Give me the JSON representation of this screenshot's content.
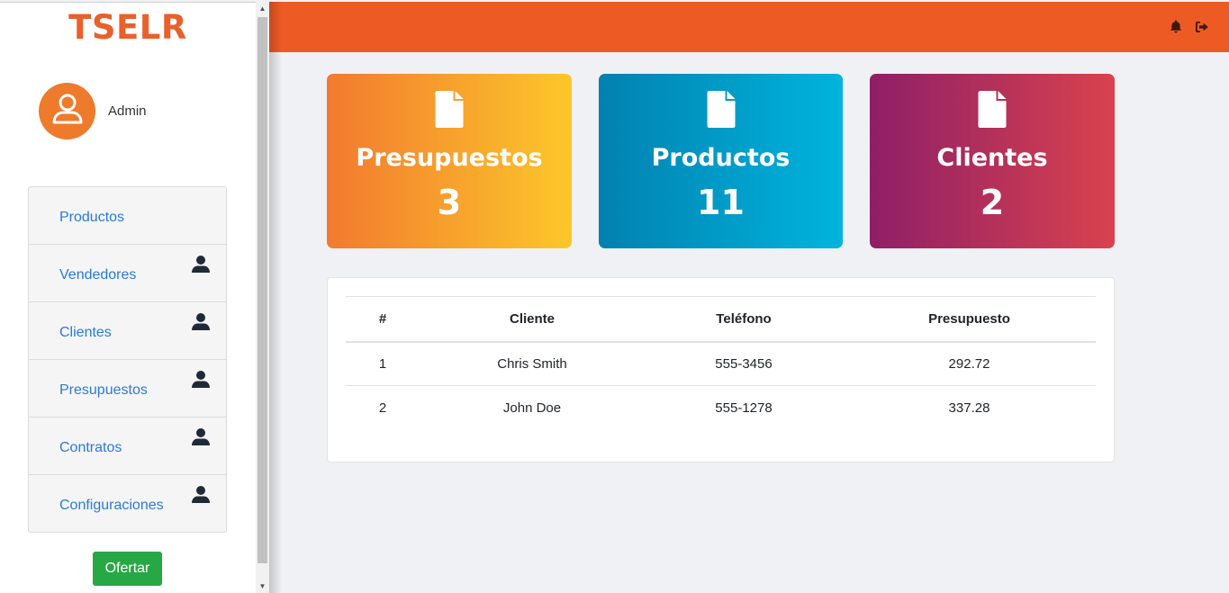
{
  "brand": "TSELR",
  "user": {
    "name": "Admin",
    "avatar_icon": "user-icon"
  },
  "menu": [
    {
      "label": "Productos",
      "icon": null
    },
    {
      "label": "Vendedores",
      "icon": "user-icon"
    },
    {
      "label": "Clientes",
      "icon": "user-icon"
    },
    {
      "label": "Presupuestos",
      "icon": "user-icon"
    },
    {
      "label": "Contratos",
      "icon": "user-icon"
    },
    {
      "label": "Configuraciones",
      "icon": "user-icon"
    }
  ],
  "ofertar_label": "Ofertar",
  "header": {
    "icons": [
      "bell-icon",
      "sign-out-icon"
    ]
  },
  "cards": [
    {
      "title": "Presupuestos",
      "value": "3",
      "icon": "file-icon"
    },
    {
      "title": "Productos",
      "value": "11",
      "icon": "file-icon"
    },
    {
      "title": "Clientes",
      "value": "2",
      "icon": "file-icon"
    }
  ],
  "table": {
    "headers": [
      "#",
      "Cliente",
      "Teléfono",
      "Presupuesto"
    ],
    "rows": [
      [
        "1",
        "Chris Smith",
        "555-3456",
        "292.72"
      ],
      [
        "2",
        "John Doe",
        "555-1278",
        "337.28"
      ]
    ]
  },
  "colors": {
    "accent": "#ee5a24",
    "brand": "#e8602c",
    "link": "#2a7bd8",
    "success": "#28a745"
  }
}
